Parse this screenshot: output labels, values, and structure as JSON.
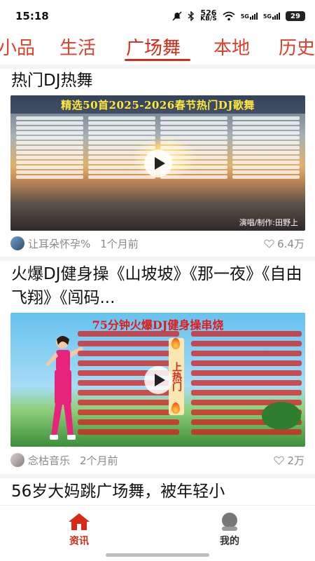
{
  "status": {
    "time": "15:18",
    "net_speed": "526",
    "net_unit": "KB/S",
    "signal1": "5G",
    "signal2": "5G",
    "battery": "29"
  },
  "tabs": [
    {
      "label": "小品"
    },
    {
      "label": "生活"
    },
    {
      "label": "广场舞",
      "active": true
    },
    {
      "label": "本地"
    },
    {
      "label": "历史"
    }
  ],
  "feed": [
    {
      "title": "热门DJ热舞",
      "thumb_text": "精选50首2025-2026春节热门DJ歌舞",
      "thumb_footer": "演唱/制作:田野上",
      "author": "让耳朵怀孕%",
      "time": "1个月前",
      "likes": "6.4万"
    },
    {
      "title": "火爆DJ健身操《山坡坡》《那一夜》《自由飞翔》《闯码...",
      "thumb_text": "75分钟火爆DJ健身操串烧",
      "thumb_vertical": "上热门",
      "author": "念枯音乐",
      "time": "2个月前",
      "likes": "2万"
    },
    {
      "title": "56岁大妈跳广场舞，被年轻小"
    }
  ],
  "bottom_nav": [
    {
      "label": "资讯",
      "icon": "home-icon",
      "active": true
    },
    {
      "label": "我的",
      "icon": "profile-icon",
      "active": false
    }
  ],
  "colors": {
    "accent": "#d42a18",
    "meta_text": "#8a8a8a"
  }
}
